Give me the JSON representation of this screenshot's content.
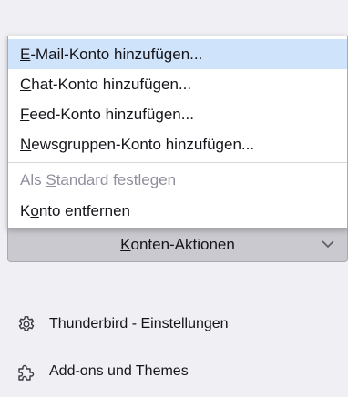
{
  "menu": {
    "items": [
      {
        "pre": "",
        "u": "E",
        "post": "-Mail-Konto hinzufügen...",
        "state": "active"
      },
      {
        "pre": "",
        "u": "C",
        "post": "hat-Konto hinzufügen...",
        "state": "normal"
      },
      {
        "pre": "",
        "u": "F",
        "post": "eed-Konto hinzufügen...",
        "state": "normal"
      },
      {
        "pre": "",
        "u": "N",
        "post": "ewsgruppen-Konto hinzufügen...",
        "state": "normal"
      },
      {
        "pre": "Als ",
        "u": "S",
        "post": "tandard festlegen",
        "state": "disabled"
      },
      {
        "pre": "K",
        "u": "o",
        "post": "nto entfernen",
        "state": "normal"
      }
    ]
  },
  "account_actions": {
    "pre": "",
    "u": "K",
    "post": "onten-Aktionen",
    "chevron_icon": "chevron-down-icon"
  },
  "side": {
    "settings_label": "Thunderbird - Einstellungen",
    "settings_icon": "gear-icon",
    "addons_label": "Add-ons und Themes",
    "addons_icon": "puzzle-icon"
  }
}
